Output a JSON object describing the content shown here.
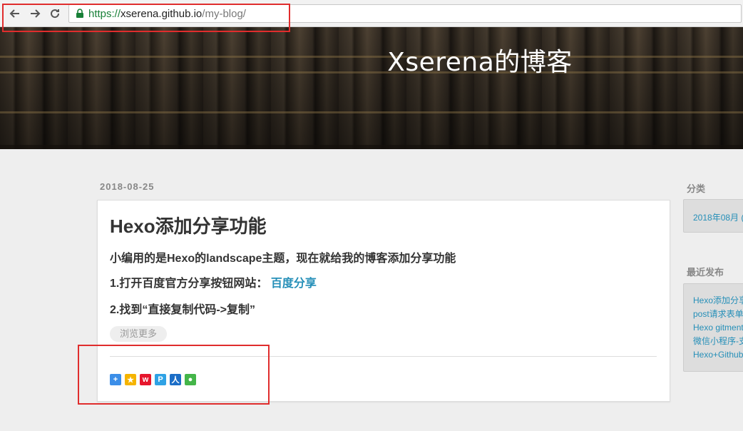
{
  "browser": {
    "url_scheme": "https://",
    "url_host": "xserena.github.io",
    "url_path": "/my-blog/"
  },
  "blog": {
    "title": "Xserena的博客"
  },
  "article": {
    "date": "2018-08-25",
    "title": "Hexo添加分享功能",
    "intro": "小编用的是Hexo的landscape主题，现在就给我的博客添加分享功能",
    "step1_text": "1.打开百度官方分享按钮网站：",
    "step1_link": "百度分享",
    "step2_text": "2.找到“直接复制代码->复制”",
    "more_label": "浏览更多",
    "share_icons": [
      "plus-share-icon",
      "qzone-icon",
      "weibo-icon",
      "tencent-weibo-icon",
      "renren-icon",
      "wechat-icon"
    ]
  },
  "sidebar": {
    "categories_title": "分类",
    "categories": [
      "2018年08月 (…"
    ],
    "recent_title": "最近发布",
    "recent_posts": [
      "Hexo添加分享…",
      "post请求表单…",
      "Hexo gitment…",
      "微信小程序-支…",
      "Hexo+Github…"
    ]
  },
  "colors": {
    "link": "#258fb8",
    "annotation_red": "#e02d2d",
    "secure_green": "#188038"
  }
}
